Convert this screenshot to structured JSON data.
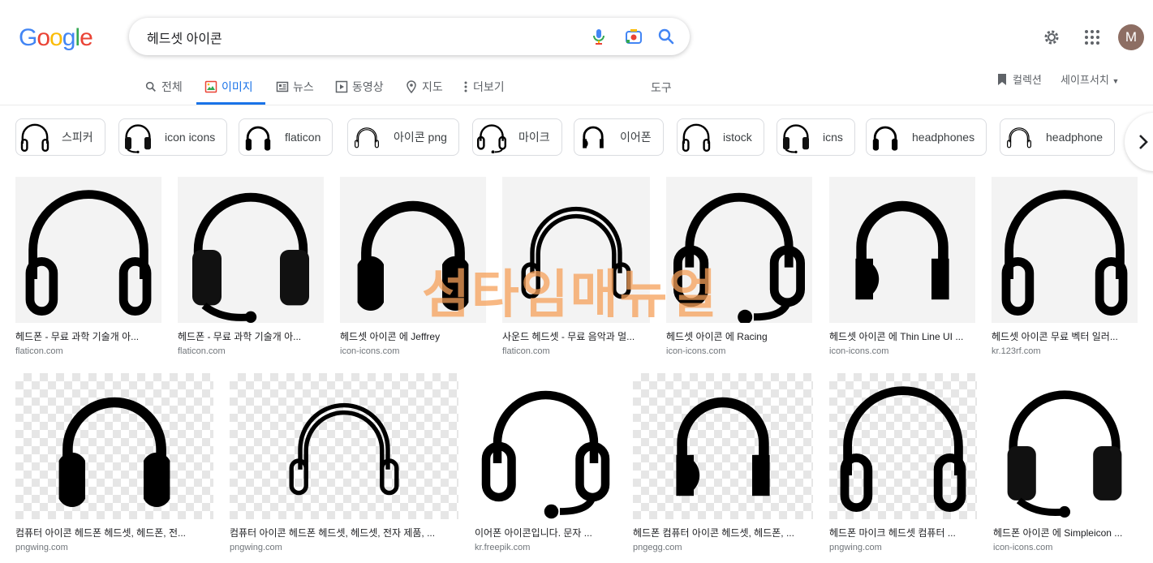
{
  "logo": {
    "text": "Google",
    "letters": [
      {
        "ch": "G",
        "color": "#4285F4"
      },
      {
        "ch": "o",
        "color": "#EA4335"
      },
      {
        "ch": "o",
        "color": "#FBBC05"
      },
      {
        "ch": "g",
        "color": "#4285F4"
      },
      {
        "ch": "l",
        "color": "#34A853"
      },
      {
        "ch": "e",
        "color": "#EA4335"
      }
    ]
  },
  "search": {
    "query": "헤드셋 아이콘",
    "icons": [
      "microphone-icon",
      "camera-lens-icon",
      "search-icon"
    ]
  },
  "header": {
    "settings_icon": "gear-icon",
    "apps_icon": "grid-icon",
    "avatar_letter": "M",
    "avatar_color": "#8d6e63"
  },
  "tabs": [
    {
      "label": "전체",
      "icon": "search-icon"
    },
    {
      "label": "이미지",
      "icon": "image-icon",
      "active": true
    },
    {
      "label": "뉴스",
      "icon": "news-icon"
    },
    {
      "label": "동영상",
      "icon": "play-icon"
    },
    {
      "label": "지도",
      "icon": "map-pin-icon"
    },
    {
      "label": "더보기",
      "icon": "more-vert-icon"
    }
  ],
  "tools_label": "도구",
  "collection_label": "컬렉션",
  "safesearch_label": "세이프서치",
  "chips": [
    "스피커",
    "icon icons",
    "flaticon",
    "아이콘 png",
    "마이크",
    "이어폰",
    "istock",
    "icns",
    "headphones",
    "headphone"
  ],
  "results_row1": [
    {
      "caption": "헤드폰 - 무료 과학 기술개 아...",
      "source": "flaticon.com"
    },
    {
      "caption": "헤드폰 - 무료 과학 기술개 아...",
      "source": "flaticon.com"
    },
    {
      "caption": "헤드셋 아이콘 에 Jeffrey",
      "source": "icon-icons.com"
    },
    {
      "caption": "사운드 헤드셋 - 무료 음악과 멀...",
      "source": "flaticon.com"
    },
    {
      "caption": "헤드셋 아이콘 에 Racing",
      "source": "icon-icons.com"
    },
    {
      "caption": "헤드셋 아이콘 에 Thin Line UI ...",
      "source": "icon-icons.com"
    },
    {
      "caption": "헤드셋 아이콘 무료 벡터 일러...",
      "source": "kr.123rf.com"
    }
  ],
  "results_row2": [
    {
      "caption": "컴퓨터 아이콘 헤드폰 헤드셋, 헤드폰, 전...",
      "source": "pngwing.com"
    },
    {
      "caption": "컴퓨터 아이콘 헤드폰 헤드셋, 헤드셋, 전자 제품, ...",
      "source": "pngwing.com"
    },
    {
      "caption": "이어폰 아이콘입니다. 문자 ...",
      "source": "kr.freepik.com"
    },
    {
      "caption": "헤드폰 컴퓨터 아이콘 헤드셋, 헤드폰, ...",
      "source": "pngegg.com"
    },
    {
      "caption": "헤드폰 마이크 헤드셋 컴퓨터 ...",
      "source": "pngwing.com"
    },
    {
      "caption": "헤드폰 아이콘 에 Simpleicon ...",
      "source": "icon-icons.com"
    }
  ],
  "watermark": "섬타임매뉴얼"
}
